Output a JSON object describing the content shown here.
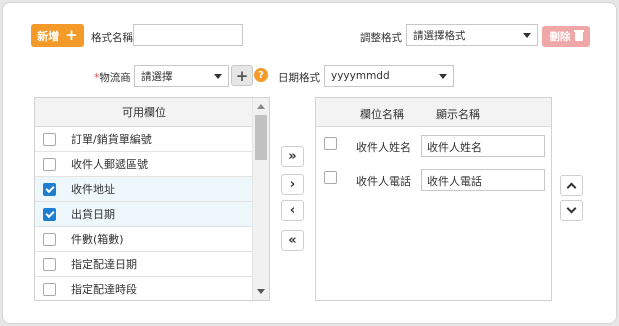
{
  "toolbar": {
    "add_label": "新增",
    "format_name_label": "格式名稱",
    "format_name_value": "",
    "adjust_format_label": "調整格式",
    "adjust_format_value": "請選擇格式",
    "delete_label": "刪除"
  },
  "row2": {
    "carrier_label": "物流商",
    "carrier_required_mark": "*",
    "carrier_value": "請選擇",
    "help_glyph": "?",
    "date_format_label": "日期格式",
    "date_format_value": "yyyymmdd"
  },
  "available": {
    "header": "可用欄位",
    "items": [
      {
        "label": "訂單/銷貨單編號",
        "checked": false
      },
      {
        "label": "收件人郵遞區號",
        "checked": false
      },
      {
        "label": "收件地址",
        "checked": true
      },
      {
        "label": "出貨日期",
        "checked": true
      },
      {
        "label": "件數(箱數)",
        "checked": false
      },
      {
        "label": "指定配達日期",
        "checked": false
      },
      {
        "label": "指定配達時段",
        "checked": false
      }
    ]
  },
  "transfer": {
    "move_all_right": "»",
    "move_right": "›",
    "move_left": "‹",
    "move_all_left": "«"
  },
  "selected": {
    "header_field": "欄位名稱",
    "header_display": "顯示名稱",
    "items": [
      {
        "field": "收件人姓名",
        "display": "收件人姓名"
      },
      {
        "field": "收件人電話",
        "display": "收件人電話"
      }
    ]
  },
  "icons": {
    "plus": "plus-icon",
    "trash": "trash-icon",
    "help": "question-icon",
    "chevron_up": "chevron-up-icon",
    "chevron_down": "chevron-down-icon"
  },
  "colors": {
    "accent": "#f39a29",
    "delete_disabled": "#f0a7a7",
    "checkbox_on": "#1e7fd0",
    "selected_row_bg": "#eef7fb"
  }
}
